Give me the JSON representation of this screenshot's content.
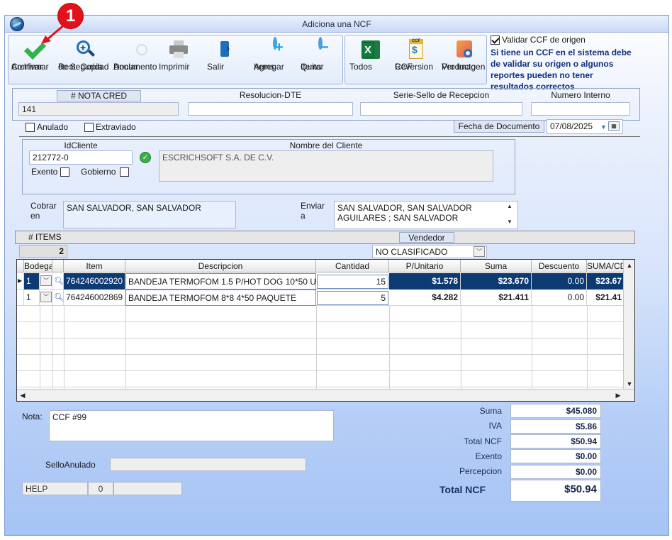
{
  "window": {
    "title": "Adiciona una NCF"
  },
  "annotation": {
    "step": "1"
  },
  "toolbar": {
    "buttons": [
      {
        "label1": "Confirmar",
        "label2": "Archivar"
      },
      {
        "label1": "Rest. Copia",
        "label2": "de Seguridad"
      },
      {
        "label1": "Anular",
        "label2": "Documento"
      },
      {
        "label1": "Imprimir",
        "label2": ""
      },
      {
        "label1": "Salir",
        "label2": ""
      },
      {
        "label1": "Agregar",
        "label2": "Items"
      },
      {
        "label1": "Quitar",
        "label2": "Items"
      }
    ],
    "buttons2": [
      {
        "label1": "Todos",
        "label2": ""
      },
      {
        "label1": "CCF",
        "label2": "Reversion"
      },
      {
        "label1": "Ver Imagen",
        "label2": "Producto"
      }
    ]
  },
  "validate": {
    "label": "Validar CCF de origen",
    "note1": "Si tiene un CCF en el sistema debe",
    "note2": "de validar su origen o algunos",
    "note3": "reportes pueden no tener",
    "note4": "resultados correctos"
  },
  "header": {
    "nota_cred_label": "# NOTA CRED",
    "nota_cred_value": "141",
    "resolucion_label": "Resolucion-DTE",
    "resolucion_value": "",
    "serie_label": "Serie-Sello de Recepcion",
    "serie_value": "",
    "numero_label": "Numero Interno",
    "numero_value": ""
  },
  "flags": {
    "anulado": "Anulado",
    "extraviado": "Extraviado"
  },
  "fecha": {
    "label": "Fecha de  Documento",
    "value": "07/08/2025"
  },
  "cliente": {
    "id_label": "IdCliente",
    "id_value": "212772-0",
    "nombre_label": "Nombre del Cliente",
    "nombre_value": "ESCRICHSOFT S.A. DE C.V.",
    "exento": "Exento",
    "gobierno": "Gobierno"
  },
  "cobrar": {
    "label1": "Cobrar",
    "label2": "en",
    "value": "SAN SALVADOR, SAN SALVADOR"
  },
  "enviar": {
    "label1": "Enviar",
    "label2": "a",
    "line1": "SAN SALVADOR, SAN SALVADOR",
    "line2": "AGUILARES ; SAN SALVADOR"
  },
  "items_bar": {
    "label": "# ITEMS",
    "count": "2"
  },
  "vendedor": {
    "label": "Vendedor",
    "value": "NO CLASIFICADO"
  },
  "grid": {
    "columns": [
      "Bodega",
      "Item",
      "Descripcion",
      "Cantidad",
      "P/Unitario",
      "Suma",
      "Descuento",
      "SUMA/CD"
    ],
    "rows": [
      {
        "bodega": "1",
        "item": "764246002920",
        "descripcion": "BANDEJA TERMOFOM 1.5 P/HOT DOG 10*50 U",
        "cantidad": "15",
        "punitario": "$1.578",
        "suma": "$23.670",
        "descuento": "0.00",
        "sumacd": "$23.67"
      },
      {
        "bodega": "1",
        "item": "764246002869",
        "descripcion": "BANDEJA TERMOFOM 8*8 4*50 PAQUETE",
        "cantidad": "5",
        "punitario": "$4.282",
        "suma": "$21.411",
        "descuento": "0.00",
        "sumacd": "$21.41"
      }
    ]
  },
  "nota": {
    "label": "Nota:",
    "value": "CCF  #99"
  },
  "sello": {
    "label": "SelloAnulado",
    "value": ""
  },
  "status": {
    "help": "HELP",
    "count": "0",
    "extra": ""
  },
  "totals": {
    "suma_label": "Suma",
    "suma_value": "$45.080",
    "iva_label": "IVA",
    "iva_value": "$5.86",
    "total_label": "Total NCF",
    "total_value": "$50.94",
    "exento_label": "Exento",
    "exento_value": "$0.00",
    "percepcion_label": "Percepcion",
    "percepcion_value": "$0.00",
    "grand_label": "Total NCF",
    "grand_value": "$50.94"
  }
}
